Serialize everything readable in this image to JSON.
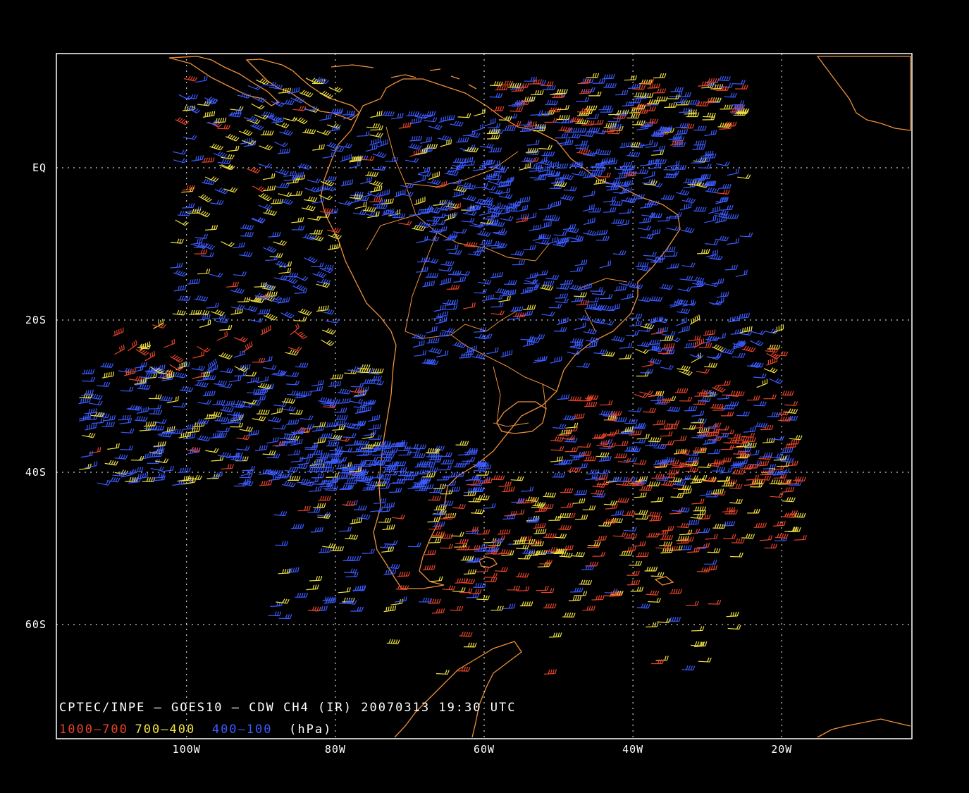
{
  "map": {
    "title": "CPTEC/INPE — GOES10 — CDW CH4 (IR) 20070313 19:30 UTC",
    "legend": [
      {
        "label": "1000—700",
        "color": "#e8442a"
      },
      {
        "label": "700—400",
        "color": "#f0e040"
      },
      {
        "label": "400—100",
        "color": "#3b5bff"
      },
      {
        "label": "(hPa)",
        "color": "#ffffff"
      }
    ],
    "lon_range": [
      -117.5,
      -2.5
    ],
    "lat_range": [
      -75,
      15
    ],
    "x_ticks": [
      {
        "lon": -100,
        "label": "100W"
      },
      {
        "lon": -80,
        "label": "80W"
      },
      {
        "lon": -60,
        "label": "60W"
      },
      {
        "lon": -40,
        "label": "40W"
      },
      {
        "lon": -20,
        "label": "20W"
      }
    ],
    "y_ticks": [
      {
        "lat": 0,
        "label": "EQ"
      },
      {
        "lat": -20,
        "label": "20S"
      },
      {
        "lat": -40,
        "label": "40S"
      },
      {
        "lat": -60,
        "label": "60S"
      }
    ],
    "colors": {
      "background": "#000000",
      "frame": "#ffffff",
      "gridlines": "#ffffff",
      "coastline": "#f0903a",
      "low_level": "#e8442a",
      "mid_level": "#f0e040",
      "high_level": "#3b5bff"
    },
    "coast_features": [
      "south-america",
      "central-america",
      "mexico",
      "africa",
      "antarctic-peninsula",
      "falkland-islands",
      "south-georgia"
    ]
  }
}
